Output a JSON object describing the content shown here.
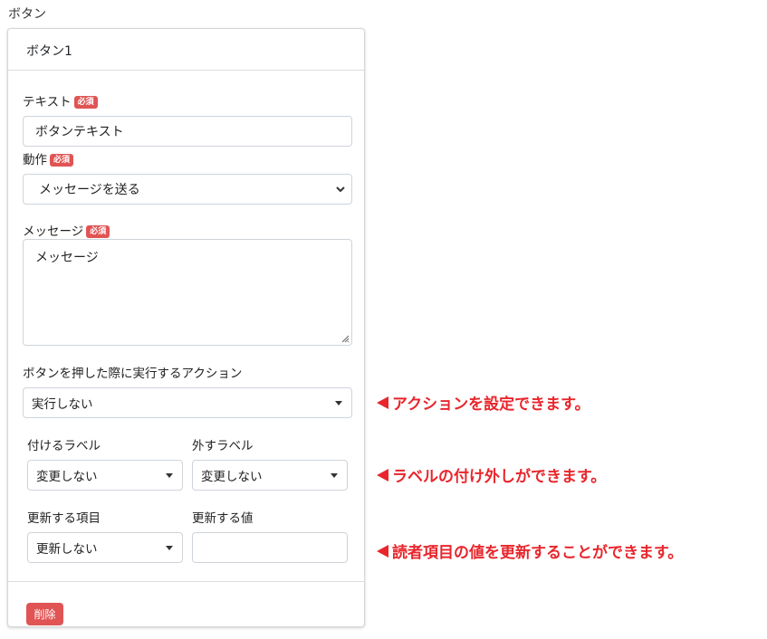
{
  "section_label": "ボタン",
  "card": {
    "title": "ボタン1",
    "required_badge": "必須",
    "text_field": {
      "label": "テキスト",
      "value": "ボタンテキスト"
    },
    "action_field": {
      "label": "動作",
      "value": "メッセージを送る"
    },
    "message_field": {
      "label": "メッセージ",
      "value": "メッセージ"
    },
    "press_action": {
      "label": "ボタンを押した際に実行するアクション",
      "value": "実行しない"
    },
    "add_label": {
      "label": "付けるラベル",
      "value": "変更しない"
    },
    "remove_label": {
      "label": "外すラベル",
      "value": "変更しない"
    },
    "update_item": {
      "label": "更新する項目",
      "value": "更新しない"
    },
    "update_value": {
      "label": "更新する値",
      "value": ""
    },
    "delete_button": "削除"
  },
  "annotations": [
    "アクションを設定できます。",
    "ラベルの付け外しができます。",
    "読者項目の値を更新することができます。"
  ],
  "colors": {
    "danger": "#e05454",
    "annotation": "#e8262c"
  }
}
